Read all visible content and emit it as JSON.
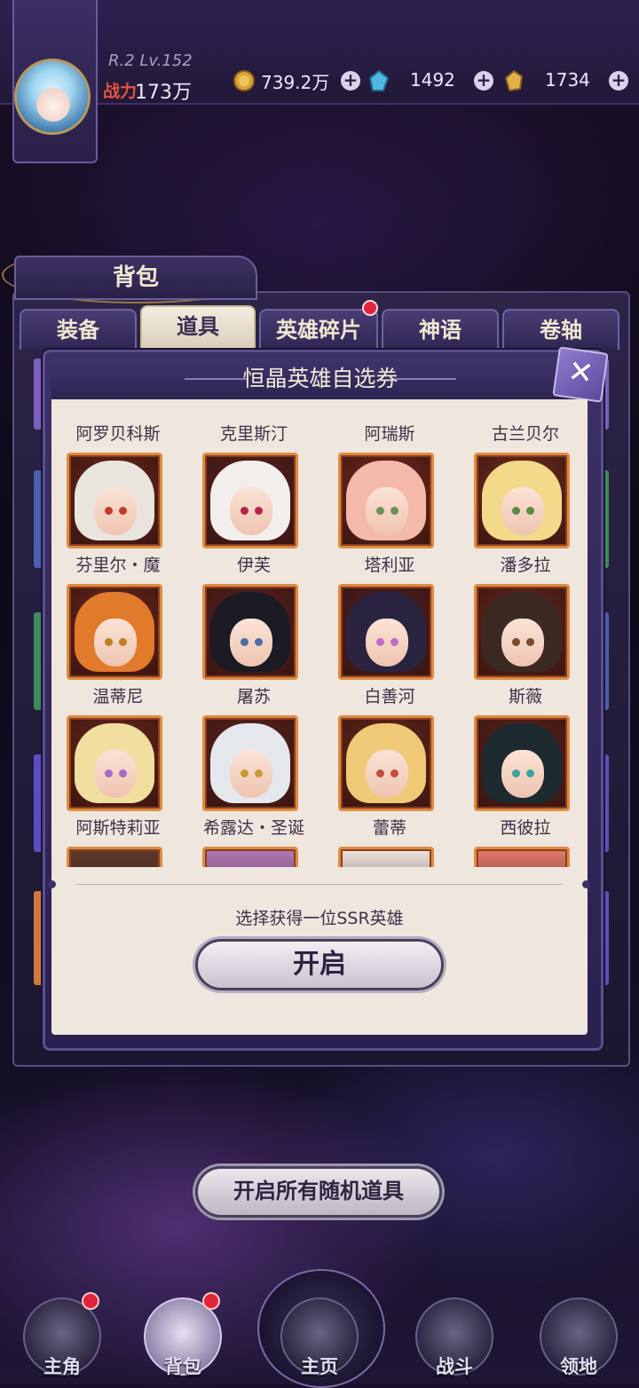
{
  "player": {
    "rank_level": "R.2 Lv.152",
    "power_label": "战力",
    "power_value": "173万"
  },
  "resources": [
    {
      "icon": "gold-coin-icon",
      "value": "739.2万"
    },
    {
      "icon": "crystal-icon",
      "value": "1492"
    },
    {
      "icon": "gold-gem-icon",
      "value": "1734"
    }
  ],
  "bag": {
    "title": "背包",
    "tabs": [
      "装备",
      "道具",
      "英雄碎片",
      "神语",
      "卷轴"
    ],
    "active_tab": "道具",
    "open_all_label": "开启所有随机道具"
  },
  "modal": {
    "title": "恒晶英雄自选券",
    "column_names": [
      "阿罗贝科斯",
      "克里斯汀",
      "阿瑞斯",
      "古兰贝尔"
    ],
    "heroes": [
      {
        "name": "芬里尔・魔",
        "hair": "#e9e4de",
        "eye": "#c23a2a",
        "bg": "#6b2a1e"
      },
      {
        "name": "伊芙",
        "hair": "#f1eeec",
        "eye": "#b32447",
        "bg": "#5a2424"
      },
      {
        "name": "塔利亚",
        "hair": "#f4b9a8",
        "eye": "#6e8f56",
        "bg": "#7a2f22"
      },
      {
        "name": "潘多拉",
        "hair": "#f3d98a",
        "eye": "#5e8a4c",
        "bg": "#7a3222"
      },
      {
        "name": "温蒂尼",
        "hair": "#e27a2c",
        "eye": "#c07d1e",
        "bg": "#6f2a1f"
      },
      {
        "name": "屠苏",
        "hair": "#1c1a22",
        "eye": "#4a6ea8",
        "bg": "#5b2322"
      },
      {
        "name": "白善河",
        "hair": "#2a2440",
        "eye": "#c06bc9",
        "bg": "#4e1f28"
      },
      {
        "name": "斯薇",
        "hair": "#3b2a22",
        "eye": "#7a4a2a",
        "bg": "#6a2a20"
      },
      {
        "name": "阿斯特莉亚",
        "hair": "#f1dfa0",
        "eye": "#a26ac7",
        "bg": "#6e2c20"
      },
      {
        "name": "希露达・圣诞",
        "hair": "#e4e8ec",
        "eye": "#c89a34",
        "bg": "#5f2622"
      },
      {
        "name": "蕾蒂",
        "hair": "#f0c976",
        "eye": "#c24c3c",
        "bg": "#6a2c20"
      },
      {
        "name": "西彼拉",
        "hair": "#1d2a2f",
        "eye": "#3aa59c",
        "bg": "#5a2420"
      }
    ],
    "partial_row_colors": [
      "#5b3a2c",
      "#b07ab8",
      "#efe6e0",
      "#e07a6c"
    ],
    "hint": "选择获得一位SSR英雄",
    "open_label": "开启",
    "close_icon": "close-icon"
  },
  "nav": [
    {
      "label": "主角",
      "icon": "hero-icon",
      "badge": true
    },
    {
      "label": "背包",
      "icon": "bag-icon",
      "badge": true,
      "active": true
    },
    {
      "label": "主页",
      "icon": "book-icon",
      "badge": false
    },
    {
      "label": "战斗",
      "icon": "swords-icon",
      "badge": false
    },
    {
      "label": "领地",
      "icon": "castle-icon",
      "badge": false
    }
  ],
  "colors": {
    "accent": "#e08a3f",
    "badge": "#e2243b",
    "panel": "#efe7de"
  }
}
